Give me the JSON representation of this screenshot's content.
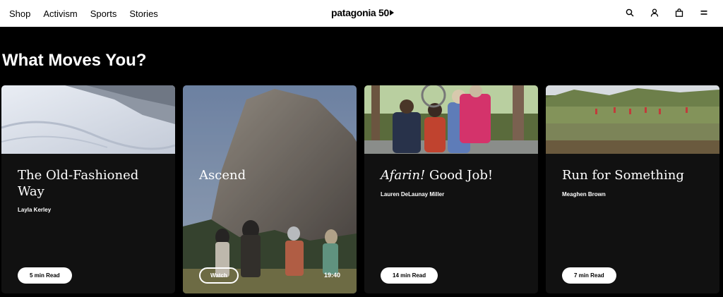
{
  "nav": {
    "items": [
      "Shop",
      "Activism",
      "Sports",
      "Stories"
    ]
  },
  "logo": {
    "text": "patagonia 50"
  },
  "header_icons": [
    "search-icon",
    "account-icon",
    "bag-icon",
    "menu-icon"
  ],
  "section": {
    "title": "What Moves You?"
  },
  "cards": [
    {
      "title": "The Old-Fashioned Way",
      "author": "Layla Kerley",
      "action": "5 min Read"
    },
    {
      "title": "Ascend",
      "action": "Watch",
      "duration": "19:40"
    },
    {
      "title_em": "Afarin!",
      "title_rest": " Good Job!",
      "author": "Lauren DeLaunay Miller",
      "action": "14 min Read"
    },
    {
      "title": "Run for Something",
      "author": "Meaghen Brown",
      "action": "7 min Read"
    }
  ],
  "colors": {
    "background": "#000000",
    "card": "#111111",
    "header": "#ffffff"
  }
}
